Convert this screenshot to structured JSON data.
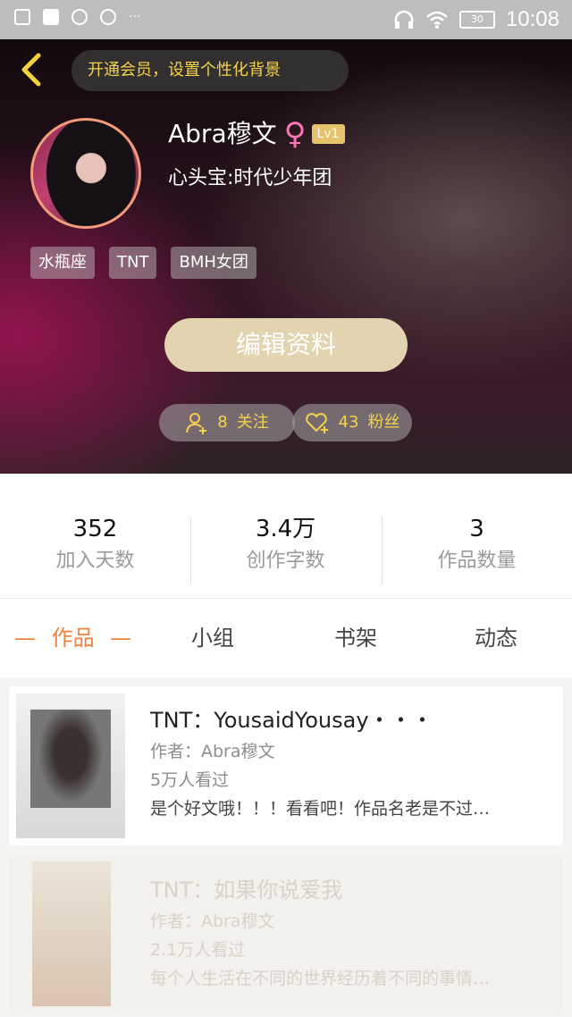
{
  "status_bar": {
    "time": "10:08",
    "battery": "30",
    "more": "···",
    "icons": [
      "image-icon",
      "square-icon",
      "search-icon",
      "qq-icon",
      "headset-icon",
      "wifi-icon",
      "battery-icon"
    ]
  },
  "header": {
    "back_icon": "chevron-left-icon",
    "vip_banner": "开通会员，设置个性化背景",
    "username": "Abra穆文",
    "gender_symbol": "♀",
    "level": "Lv1",
    "heart_idol": "心头宝:时代少年团",
    "tags": [
      "水瓶座",
      "TNT",
      "BMH女团"
    ],
    "edit_button": "编辑资料",
    "follow": {
      "count": "8",
      "label": "关注",
      "icon": "user-plus-icon"
    },
    "fans": {
      "count": "43",
      "label": "粉丝",
      "icon": "heart-plus-icon"
    }
  },
  "stats": [
    {
      "value": "352",
      "label": "加入天数"
    },
    {
      "value": "3.4万",
      "label": "创作字数"
    },
    {
      "value": "3",
      "label": "作品数量"
    }
  ],
  "tabs": {
    "active_dash": "—",
    "items": [
      "作品",
      "小组",
      "书架",
      "动态"
    ]
  },
  "works": [
    {
      "title": "TNT：YousaidYousay・・・",
      "author": "作者：Abra穆文",
      "views": "5万人看过",
      "desc": "是个好文哦！！！看看吧！作品名老是不过…"
    },
    {
      "title": "TNT：如果你说爱我",
      "author": "作者：Abra穆文",
      "views": "2.1万人看过",
      "desc": "每个人生活在不同的世界经历着不同的事情…"
    }
  ]
}
